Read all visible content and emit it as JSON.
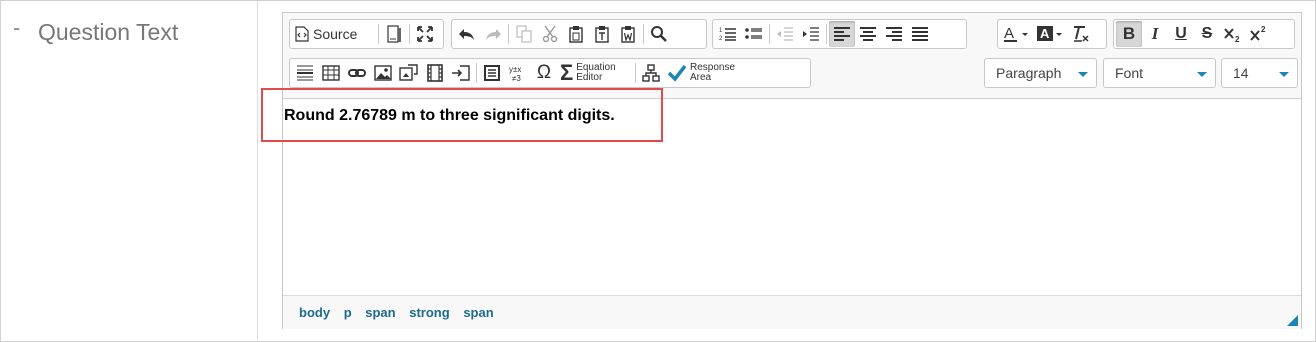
{
  "field": {
    "dash": "-",
    "label": "Question Text"
  },
  "toolbar": {
    "source_label": "Source",
    "equation_label_line1": "Equation",
    "equation_label_line2": "Editor",
    "response_label_line1": "Response",
    "response_label_line2": "Area",
    "bold_glyph": "B",
    "italic_glyph": "I",
    "underline_glyph": "U",
    "strike_glyph": "S",
    "omega_glyph": "Ω",
    "sigma_glyph": "Σ",
    "paragraph_select": "Paragraph",
    "font_select": "Font",
    "size_select": "14",
    "icons": [
      "source-icon",
      "templates-icon",
      "maximize-icon",
      "undo-icon",
      "redo-icon",
      "copy-icon",
      "cut-icon",
      "paste-icon",
      "paste-text-icon",
      "paste-word-icon",
      "find-icon",
      "numbered-list-icon",
      "bulleted-list-icon",
      "outdent-icon",
      "indent-icon",
      "align-left-icon",
      "align-center-icon",
      "align-right-icon",
      "justify-icon",
      "text-color-icon",
      "background-color-icon",
      "remove-format-icon",
      "bold-icon",
      "italic-icon",
      "underline-icon",
      "strikethrough-icon",
      "subscript-icon",
      "superscript-icon",
      "horizontal-line-icon",
      "table-icon",
      "link-icon",
      "image-icon",
      "media-icon",
      "video-icon",
      "insert-icon",
      "blockquote-icon",
      "math-icon",
      "special-char-icon",
      "equation-icon",
      "hierarchy-icon",
      "checkmark-icon"
    ],
    "accent_color": "#1a86b8"
  },
  "content": {
    "text": "Round 2.76789 m to three significant digits."
  },
  "status_path": [
    "body",
    "p",
    "span",
    "strong",
    "span"
  ],
  "colors": {
    "highlight_border": "#e24b4b",
    "path_link": "#1e6a8e"
  }
}
